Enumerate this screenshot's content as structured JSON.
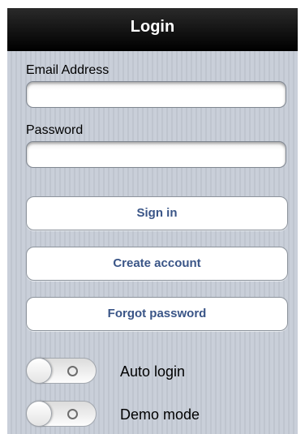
{
  "navbar": {
    "title": "Login"
  },
  "form": {
    "email": {
      "label": "Email Address",
      "value": "",
      "placeholder": ""
    },
    "password": {
      "label": "Password",
      "value": "",
      "placeholder": ""
    }
  },
  "buttons": {
    "sign_in": "Sign in",
    "create_account": "Create account",
    "forgot_password": "Forgot password"
  },
  "toggles": [
    {
      "label": "Auto login",
      "state": "off"
    },
    {
      "label": "Demo mode",
      "state": "off"
    }
  ],
  "colors": {
    "button_text": "#3a5587",
    "navbar": "#000000",
    "background": "#c6ccd6"
  }
}
